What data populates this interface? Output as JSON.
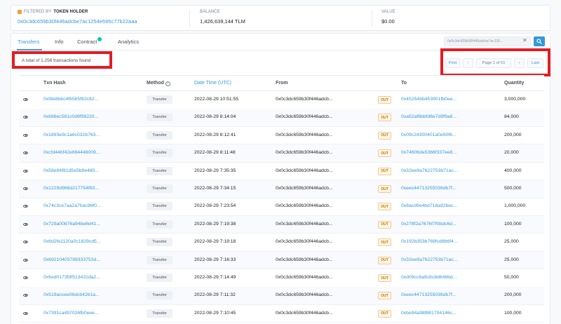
{
  "filter": {
    "holder_label_prefix": "FILTERED BY",
    "holder_label_strong": "TOKEN HOLDER",
    "holder_address": "0x0c3dc659b30f446adcbe7ac1254e695c77b22aaa",
    "balance_label": "BALANCE",
    "balance_value": "1,426,639,144 TLM",
    "value_label": "VALUE",
    "value_value": "$0.00"
  },
  "tabs": {
    "transfers": "Transfers",
    "info": "Info",
    "contract": "Contract",
    "analytics": "Analytics"
  },
  "search": {
    "value": "0x0c3dc659b30f446adcbe7ac126..."
  },
  "summary": {
    "total_text": "A total of 1,256 transactions found"
  },
  "pagination": {
    "first": "First",
    "prev": "‹",
    "page_text": "Page 1 of 51",
    "next": "›",
    "last": "Last"
  },
  "table": {
    "headers": {
      "txn_hash": "Txn Hash",
      "method": "Method",
      "datetime": "Date Time (UTC)",
      "from": "From",
      "to": "To",
      "quantity": "Quantity"
    },
    "rows": [
      {
        "hash": "0xf8e8b8c4f65b5f82c82...",
        "method": "Transfer",
        "time": "2022-08-29 10:51:55",
        "from": "0x0c3dc659b30f446adcb...",
        "dir": "OUT",
        "to": "0x45254bb453901fb0ee...",
        "qty": "3,000,000"
      },
      {
        "hash": "0x686ec581c0d9f98220...",
        "method": "Transfer",
        "time": "2022-08-29 8:14:04",
        "from": "0x0c3dc659b30f446adcb...",
        "dir": "OUT",
        "to": "0xa52af8bbfd6e7d9f9a8...",
        "qty": "84,000"
      },
      {
        "hash": "0x1893e9c1a6c032b763...",
        "method": "Transfer",
        "time": "2022-08-29 8:12:41",
        "from": "0x0c3dc659b30f446adcb...",
        "dir": "OUT",
        "to": "0x09c24300401a0e50f6...",
        "qty": "200,000"
      },
      {
        "hash": "0xcfd44bf42e694446009...",
        "method": "Transfer",
        "time": "2022-08-29 8:11:48",
        "from": "0x0c3dc659b30f446adcb...",
        "dir": "OUT",
        "to": "0x74606de5366f337ee8...",
        "qty": "20,000"
      },
      {
        "hash": "0x58e84f81d5e5b8e480...",
        "method": "Transfer",
        "time": "2022-08-29 7:35:35",
        "from": "0x0c3dc659b30f446adcb...",
        "dir": "OUT",
        "to": "0x32ee9a7622753b71ac...",
        "qty": "400,000"
      },
      {
        "hash": "0x1229d968d217754f83...",
        "method": "Transfer",
        "time": "2022-08-29 7:34:15",
        "from": "0x0c3dc659b30f446adcb...",
        "dir": "OUT",
        "to": "0xeec44713255036db7f...",
        "qty": "500,000"
      },
      {
        "hash": "0x74c3ce7aa2a7bac96f0...",
        "method": "Transfer",
        "time": "2022-08-29 7:23:54",
        "from": "0x0c3dc659b30f446adcb...",
        "dir": "OUT",
        "to": "0x8acd9e4bd718a92bec...",
        "qty": "1,000,000"
      },
      {
        "hash": "0x729a00876a94be6d41...",
        "method": "Transfer",
        "time": "2022-08-29 7:19:38",
        "from": "0x0c3dc659b30f446adcb...",
        "dir": "OUT",
        "to": "0x278f2a7676f7f0bdc6d...",
        "qty": "100,000"
      },
      {
        "hash": "0x6d2fe1120a0c1829cd5...",
        "method": "Transfer",
        "time": "2022-08-29 7:19:18",
        "from": "0x0c3dc659b30f446adcb...",
        "dir": "OUT",
        "to": "0x192b353b769fcd8b6f4...",
        "qty": "25,000"
      },
      {
        "hash": "0x69210403788333753d...",
        "method": "Transfer",
        "time": "2022-08-29 7:16:33",
        "from": "0x0c3dc659b30f446adcb...",
        "dir": "OUT",
        "to": "0x32ee9a7622753b71ac...",
        "qty": "25,000"
      },
      {
        "hash": "0x6ed0173fdf513431da2...",
        "method": "Transfer",
        "time": "2022-08-29 7:14:49",
        "from": "0x0c3dc659b30f446adcb...",
        "dir": "OUT",
        "to": "0xd09cc6a9c8c8d646bd...",
        "qty": "50,000"
      },
      {
        "hash": "0x519accee06dcb42b1a...",
        "method": "Transfer",
        "time": "2022-08-29 7:11:32",
        "from": "0x0c3dc659b30f446adcb...",
        "dir": "OUT",
        "to": "0xeec44713255036db7f...",
        "qty": "200,000"
      },
      {
        "hash": "0x7391ca497026fb0eee...",
        "method": "Transfer",
        "time": "2022-08-29 7:10:45",
        "from": "0x0c3dc659b30f446adcb...",
        "dir": "OUT",
        "to": "0xbe94a98f881704146c...",
        "qty": "100,000"
      }
    ]
  }
}
